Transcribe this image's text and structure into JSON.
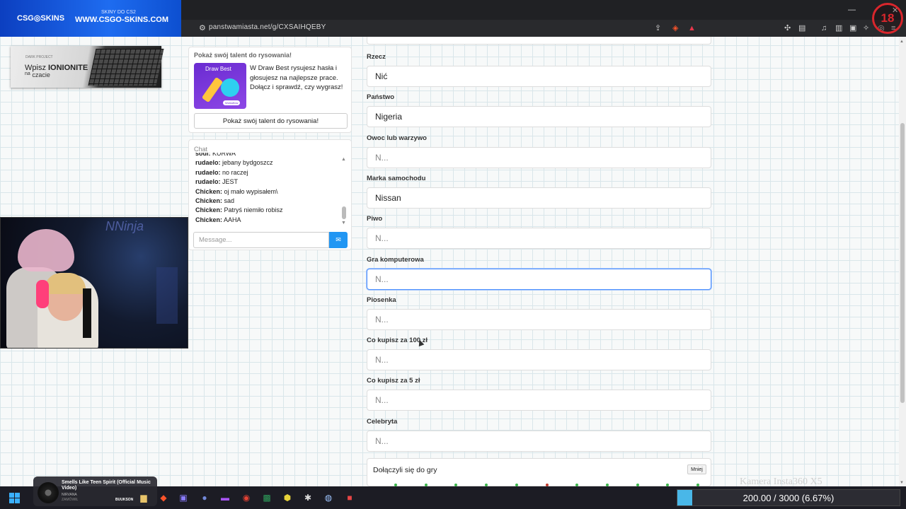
{
  "browser": {
    "url": "panstwamiasta.net/g/CXSAIHQEBY"
  },
  "promo": {
    "tagline": "SKINY DO CS2",
    "logo": "CSG◎SKINS",
    "site": "WWW.CSGO-SKINS.COM",
    "age_badge": "18"
  },
  "ad": {
    "brand": "DARK PROJECT",
    "line1_prefix": "Wpisz ",
    "line1_code": "IONIONITE",
    "line2_small": "na",
    "line2": "czacie"
  },
  "draw_card": {
    "title": "Pokaż swój talent do rysowania!",
    "image_title": "Draw Best",
    "image_badge": "Wolnoflow",
    "text": "W Draw Best rysujesz hasła i głosujesz na najlepsze prace. Dołącz i sprawdź, czy wygrasz!",
    "button": "Pokaż swój talent do rysowania!"
  },
  "chat": {
    "title": "Chat",
    "messages": [
      {
        "user": "soul:",
        "text": " KURWA"
      },
      {
        "user": "rudaelo:",
        "text": " jebany bydgoszcz"
      },
      {
        "user": "rudaelo:",
        "text": " no raczej"
      },
      {
        "user": "rudaelo:",
        "text": " JEST"
      },
      {
        "user": "Chicken:",
        "text": " oj mało wypisałem\\"
      },
      {
        "user": "Chicken:",
        "text": " sad"
      },
      {
        "user": "Chicken:",
        "text": " Patryś niemiło robisz"
      },
      {
        "user": "Chicken:",
        "text": " AAHA"
      }
    ],
    "placeholder": "Message..."
  },
  "form": {
    "fields": [
      {
        "label": "Rzecz",
        "value": "Nić",
        "placeholder": "N..."
      },
      {
        "label": "Państwo",
        "value": "Nigeria",
        "placeholder": "N..."
      },
      {
        "label": "Owoc lub warzywo",
        "value": "",
        "placeholder": "N..."
      },
      {
        "label": "Marka samochodu",
        "value": "Nissan",
        "placeholder": "N..."
      },
      {
        "label": "Piwo",
        "value": "",
        "placeholder": "N..."
      },
      {
        "label": "Gra komputerowa",
        "value": "",
        "placeholder": "N..."
      },
      {
        "label": "Piosenka",
        "value": "",
        "placeholder": "N..."
      },
      {
        "label": "Co kupisz za 100 zł",
        "value": "",
        "placeholder": "N..."
      },
      {
        "label": "Co kupisz za 5 zł",
        "value": "",
        "placeholder": "N..."
      },
      {
        "label": "Celebryta",
        "value": "",
        "placeholder": "N..."
      }
    ],
    "focused_field": "Gra komputerowa",
    "joined_title": "Dołączyli się do gry",
    "less_button": "Mniej"
  },
  "stream": {
    "camera_tag": "Kamera Insta360 X5",
    "neon": "NNinja"
  },
  "music": {
    "title": "Smells Like Teen Spirit (Official Music Video)",
    "artist": "NIRVANA",
    "cover_label": "ZAMÓWIŁ",
    "next_label": "BUUKSON"
  },
  "goal": {
    "text": "200.00 / 3000 (6.67%)",
    "fraction": 0.0667
  },
  "colors": {
    "accent": "#2196f3",
    "focus": "#4d90fe",
    "dot_green": "#3ab54a",
    "dot_red": "#c0392b",
    "goal_fill": "#49b7e8"
  },
  "icons": {
    "taskbar": [
      "windows-icon",
      "search-icon",
      "file-explorer-icon",
      "brave-icon",
      "teams-icon",
      "discord-icon",
      "nzxt-icon",
      "obs-icon",
      "excel-icon",
      "hexagon-app-icon",
      "settings-icon",
      "steam-icon",
      "antivirus-icon"
    ],
    "browser": [
      "share-icon",
      "brave-shield-icon",
      "rewards-icon",
      "extensions-icon",
      "reader-icon",
      "music-icon",
      "sidebar-icon",
      "wallet-icon",
      "leo-icon",
      "vpn-icon",
      "menu-icon"
    ]
  }
}
